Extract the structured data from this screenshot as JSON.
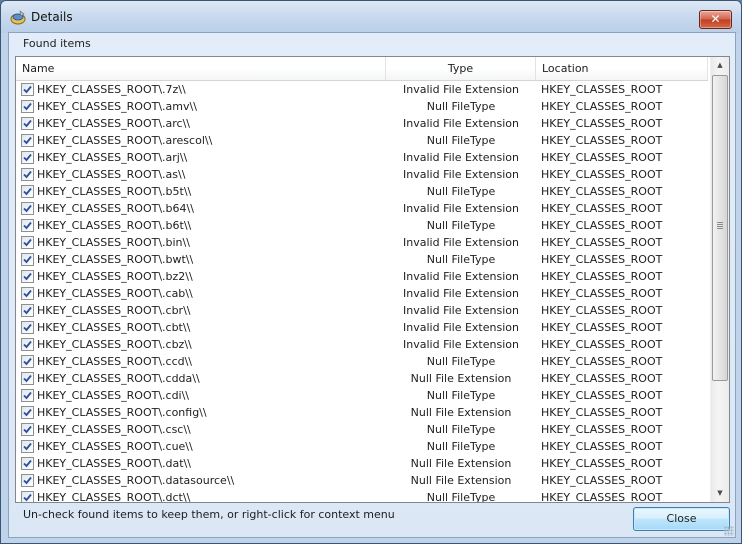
{
  "window": {
    "title": "Details",
    "icon": "app-wrench-icon",
    "close_glyph": "✕"
  },
  "section_label": "Found items",
  "table": {
    "columns": [
      "Name",
      "Type",
      "Location"
    ],
    "rows": [
      {
        "checked": true,
        "name": "HKEY_CLASSES_ROOT\\.7z\\\\",
        "type": "Invalid File Extension",
        "location": "HKEY_CLASSES_ROOT"
      },
      {
        "checked": true,
        "name": "HKEY_CLASSES_ROOT\\.amv\\\\",
        "type": "Null FileType",
        "location": "HKEY_CLASSES_ROOT"
      },
      {
        "checked": true,
        "name": "HKEY_CLASSES_ROOT\\.arc\\\\",
        "type": "Invalid File Extension",
        "location": "HKEY_CLASSES_ROOT"
      },
      {
        "checked": true,
        "name": "HKEY_CLASSES_ROOT\\.arescol\\\\",
        "type": "Null FileType",
        "location": "HKEY_CLASSES_ROOT"
      },
      {
        "checked": true,
        "name": "HKEY_CLASSES_ROOT\\.arj\\\\",
        "type": "Invalid File Extension",
        "location": "HKEY_CLASSES_ROOT"
      },
      {
        "checked": true,
        "name": "HKEY_CLASSES_ROOT\\.as\\\\",
        "type": "Invalid File Extension",
        "location": "HKEY_CLASSES_ROOT"
      },
      {
        "checked": true,
        "name": "HKEY_CLASSES_ROOT\\.b5t\\\\",
        "type": "Null FileType",
        "location": "HKEY_CLASSES_ROOT"
      },
      {
        "checked": true,
        "name": "HKEY_CLASSES_ROOT\\.b64\\\\",
        "type": "Invalid File Extension",
        "location": "HKEY_CLASSES_ROOT"
      },
      {
        "checked": true,
        "name": "HKEY_CLASSES_ROOT\\.b6t\\\\",
        "type": "Null FileType",
        "location": "HKEY_CLASSES_ROOT"
      },
      {
        "checked": true,
        "name": "HKEY_CLASSES_ROOT\\.bin\\\\",
        "type": "Invalid File Extension",
        "location": "HKEY_CLASSES_ROOT"
      },
      {
        "checked": true,
        "name": "HKEY_CLASSES_ROOT\\.bwt\\\\",
        "type": "Null FileType",
        "location": "HKEY_CLASSES_ROOT"
      },
      {
        "checked": true,
        "name": "HKEY_CLASSES_ROOT\\.bz2\\\\",
        "type": "Invalid File Extension",
        "location": "HKEY_CLASSES_ROOT"
      },
      {
        "checked": true,
        "name": "HKEY_CLASSES_ROOT\\.cab\\\\",
        "type": "Invalid File Extension",
        "location": "HKEY_CLASSES_ROOT"
      },
      {
        "checked": true,
        "name": "HKEY_CLASSES_ROOT\\.cbr\\\\",
        "type": "Invalid File Extension",
        "location": "HKEY_CLASSES_ROOT"
      },
      {
        "checked": true,
        "name": "HKEY_CLASSES_ROOT\\.cbt\\\\",
        "type": "Invalid File Extension",
        "location": "HKEY_CLASSES_ROOT"
      },
      {
        "checked": true,
        "name": "HKEY_CLASSES_ROOT\\.cbz\\\\",
        "type": "Invalid File Extension",
        "location": "HKEY_CLASSES_ROOT"
      },
      {
        "checked": true,
        "name": "HKEY_CLASSES_ROOT\\.ccd\\\\",
        "type": "Null FileType",
        "location": "HKEY_CLASSES_ROOT"
      },
      {
        "checked": true,
        "name": "HKEY_CLASSES_ROOT\\.cdda\\\\",
        "type": "Null File Extension",
        "location": "HKEY_CLASSES_ROOT"
      },
      {
        "checked": true,
        "name": "HKEY_CLASSES_ROOT\\.cdi\\\\",
        "type": "Null FileType",
        "location": "HKEY_CLASSES_ROOT"
      },
      {
        "checked": true,
        "name": "HKEY_CLASSES_ROOT\\.config\\\\",
        "type": "Null File Extension",
        "location": "HKEY_CLASSES_ROOT"
      },
      {
        "checked": true,
        "name": "HKEY_CLASSES_ROOT\\.csc\\\\",
        "type": "Null FileType",
        "location": "HKEY_CLASSES_ROOT"
      },
      {
        "checked": true,
        "name": "HKEY_CLASSES_ROOT\\.cue\\\\",
        "type": "Null FileType",
        "location": "HKEY_CLASSES_ROOT"
      },
      {
        "checked": true,
        "name": "HKEY_CLASSES_ROOT\\.dat\\\\",
        "type": "Null File Extension",
        "location": "HKEY_CLASSES_ROOT"
      },
      {
        "checked": true,
        "name": "HKEY_CLASSES_ROOT\\.datasource\\\\",
        "type": "Null File Extension",
        "location": "HKEY_CLASSES_ROOT"
      },
      {
        "checked": true,
        "name": "HKEY_CLASSES_ROOT\\.dct\\\\",
        "type": "Null FileType",
        "location": "HKEY_CLASSES_ROOT"
      }
    ]
  },
  "scrollbar": {
    "up_glyph": "▲",
    "down_glyph": "▼",
    "thumb_position_fraction": 0.0,
    "visible_fraction": 0.74
  },
  "footer": {
    "hint": "Un-check found items to keep them, or right-click for context menu",
    "close_label": "Close"
  }
}
